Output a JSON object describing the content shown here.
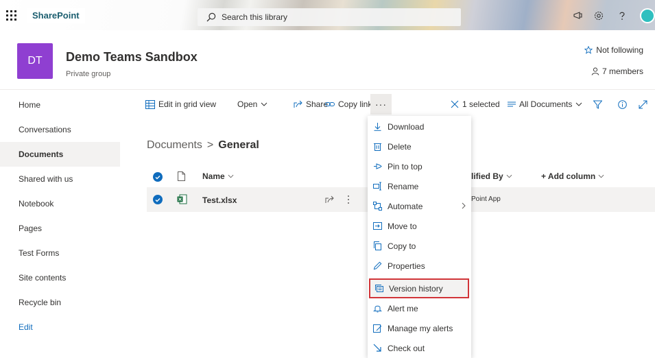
{
  "suite": {
    "app_name": "SharePoint",
    "search_placeholder": "Search this library"
  },
  "site": {
    "logo_initials": "DT",
    "title": "Demo Teams Sandbox",
    "subtitle": "Private group",
    "follow_label": "Not following",
    "members_label": "7 members",
    "logo_color": "#8f3fd1"
  },
  "nav": {
    "items": [
      {
        "label": "Home"
      },
      {
        "label": "Conversations"
      },
      {
        "label": "Documents"
      },
      {
        "label": "Shared with us"
      },
      {
        "label": "Notebook"
      },
      {
        "label": "Pages"
      },
      {
        "label": "Test Forms"
      },
      {
        "label": "Site contents"
      },
      {
        "label": "Recycle bin"
      },
      {
        "label": "Edit"
      }
    ],
    "active": "Documents"
  },
  "commandbar": {
    "edit_grid": "Edit in grid view",
    "open": "Open",
    "share": "Share",
    "copy_link": "Copy link",
    "more": "···",
    "selected": "1 selected",
    "view": "All Documents"
  },
  "breadcrumb": {
    "parent": "Documents",
    "separator": ">",
    "current": "General"
  },
  "table": {
    "col_name": "Name",
    "col_modified_by": "lified By",
    "col_add": "+ Add column",
    "rows": [
      {
        "name": "Test.xlsx",
        "modified_by": "Point App"
      }
    ]
  },
  "menu": {
    "items": [
      {
        "label": "Download",
        "icon": "download-icon"
      },
      {
        "label": "Delete",
        "icon": "trash-icon"
      },
      {
        "label": "Pin to top",
        "icon": "pin-icon"
      },
      {
        "label": "Rename",
        "icon": "rename-icon"
      },
      {
        "label": "Automate",
        "icon": "flow-icon"
      },
      {
        "label": "Move to",
        "icon": "move-icon"
      },
      {
        "label": "Copy to",
        "icon": "copy-icon"
      },
      {
        "label": "Properties",
        "icon": "pencil-icon"
      },
      {
        "label": "Version history",
        "icon": "history-icon"
      },
      {
        "label": "Alert me",
        "icon": "bell-icon"
      },
      {
        "label": "Manage my alerts",
        "icon": "manage-alerts-icon"
      },
      {
        "label": "Check out",
        "icon": "checkout-icon"
      }
    ],
    "highlight_color": "#d13438"
  },
  "colors": {
    "accent": "#0f6cbd",
    "excel": "#1d6f42"
  }
}
